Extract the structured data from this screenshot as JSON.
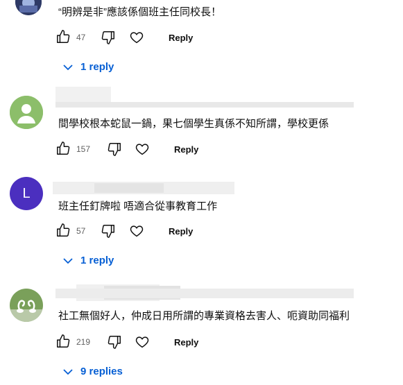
{
  "comments": [
    {
      "text": "“明辨是非”應該係個班主任同校長！",
      "likes": "47",
      "reply_label": "Reply",
      "replies_label": "1 reply"
    },
    {
      "text": "間學校根本蛇鼠一鍋，果七個學生真係不知所謂，學校更係",
      "likes": "157",
      "reply_label": "Reply",
      "avatar_color": "#8cbe6a"
    },
    {
      "avatar_letter": "L",
      "avatar_color": "#4b2fbf",
      "text": "班主任釘牌啦 唔適合從事教育工作",
      "likes": "57",
      "reply_label": "Reply",
      "replies_label": "1 reply"
    },
    {
      "text": "社工無個好人，仲成日用所謂的專業資格去害人、呃資助同福利",
      "likes": "219",
      "reply_label": "Reply",
      "replies_label": "9 replies"
    }
  ],
  "accent_color": "#065fd4"
}
